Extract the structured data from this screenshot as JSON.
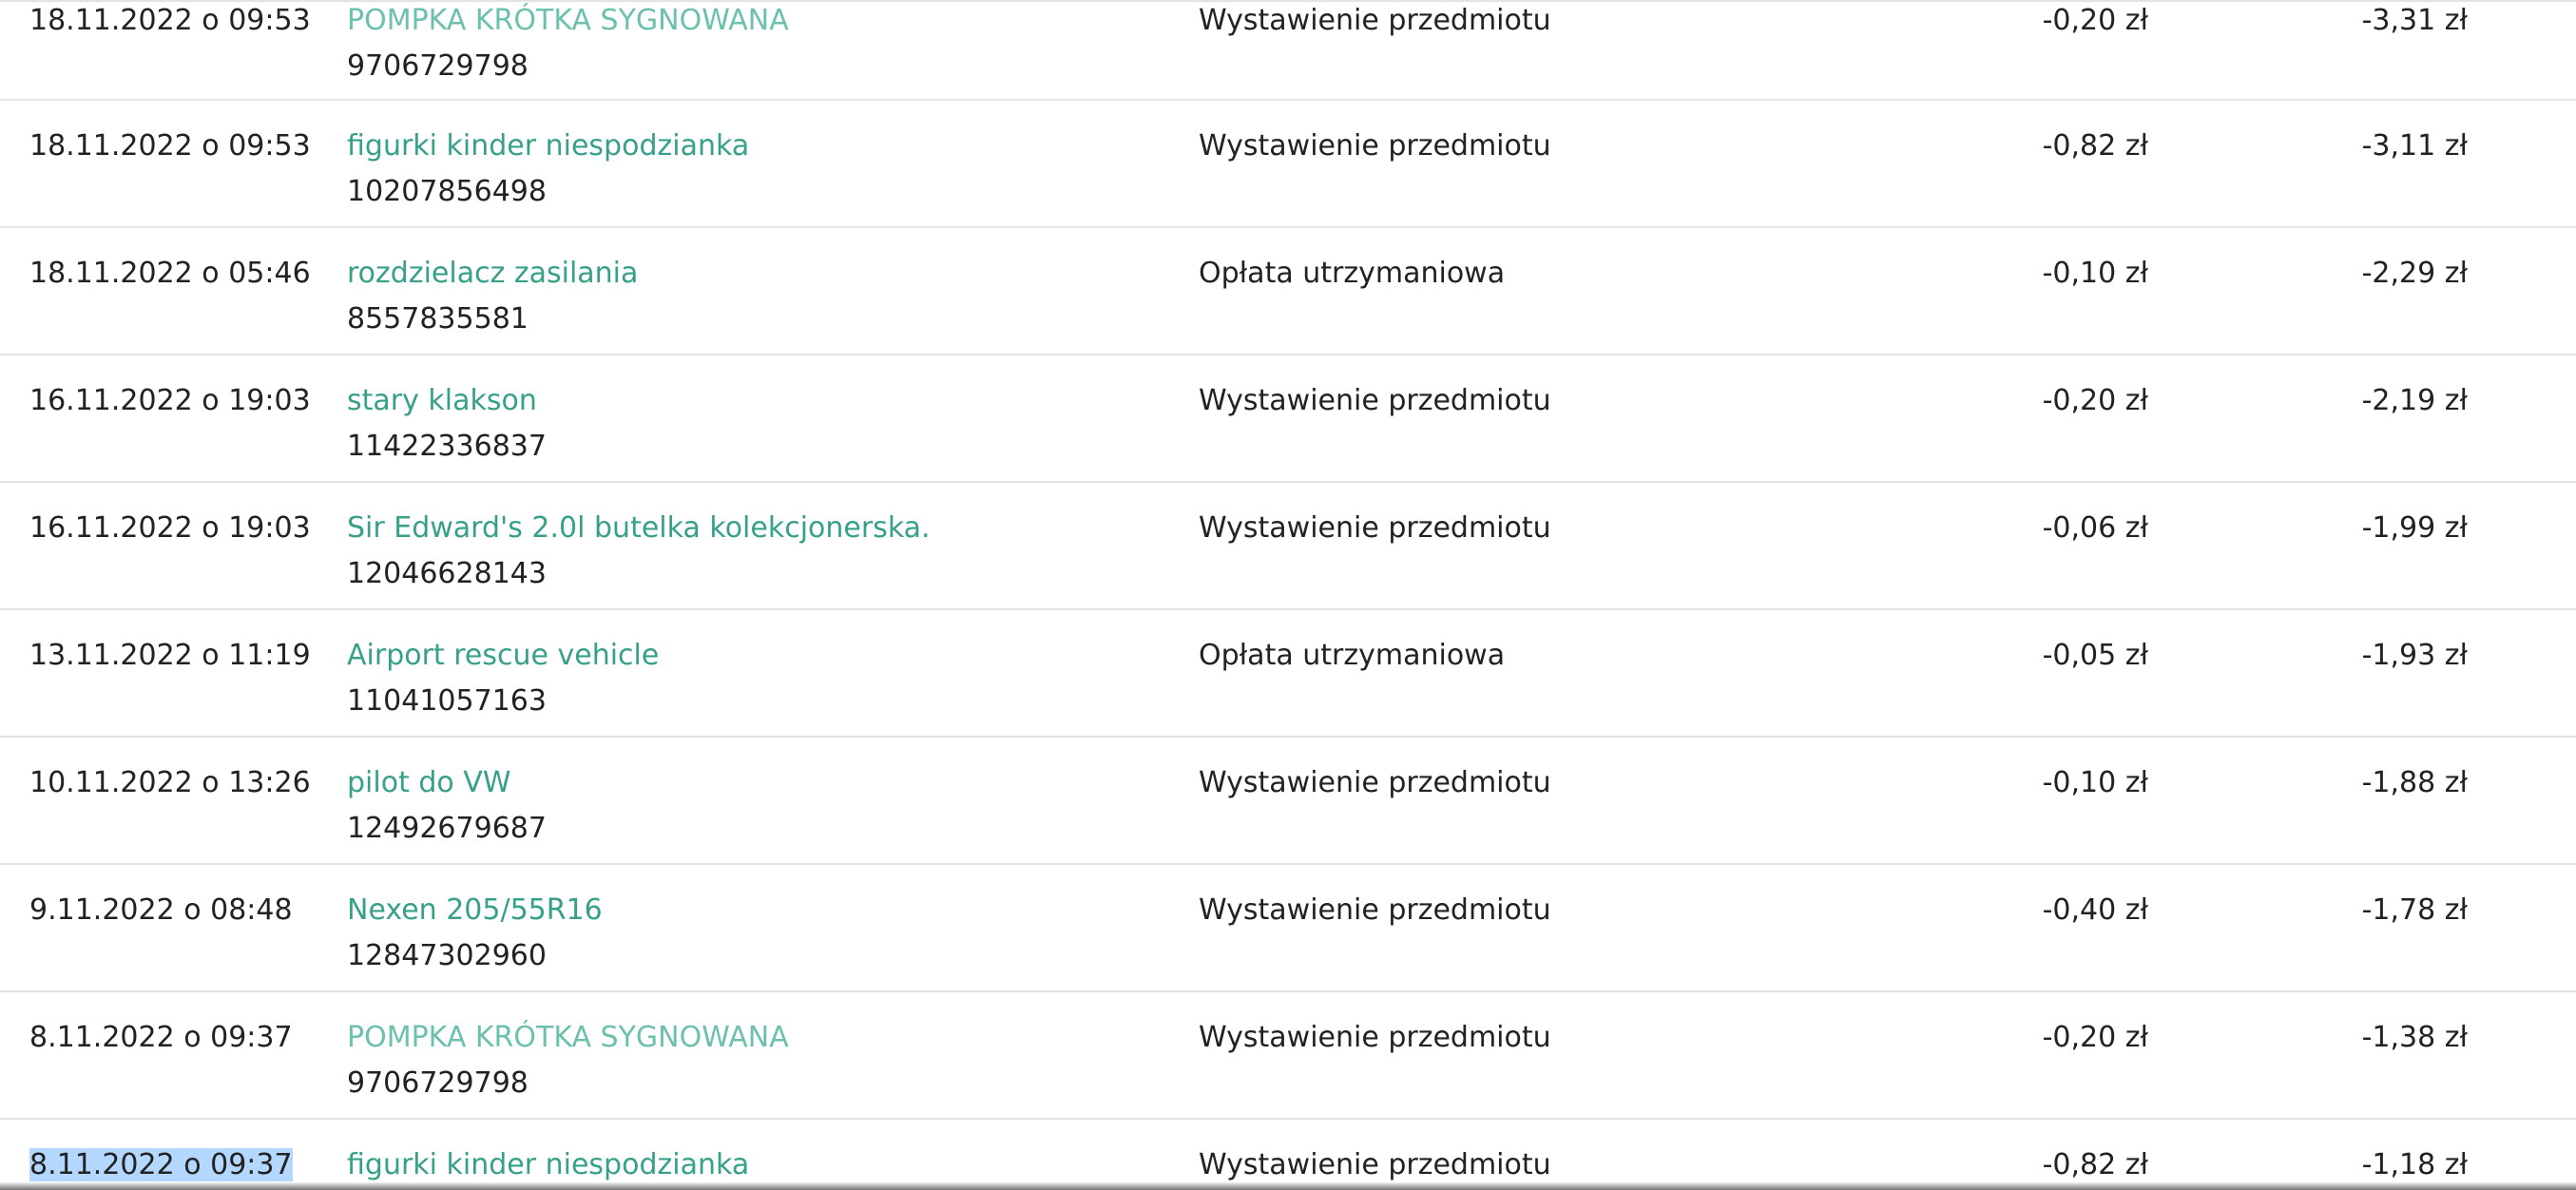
{
  "rows": [
    {
      "date": "18.11.2022 o 09:53",
      "title": "POMPKA KRÓTKA SYGNOWANA",
      "offer_id": "9706729798",
      "type": "Wystawienie przedmiotu",
      "amount": "-0,20 zł",
      "balance": "-3,31 zł"
    },
    {
      "date": "18.11.2022 o 09:53",
      "title": "figurki kinder niespodzianka",
      "offer_id": "10207856498",
      "type": "Wystawienie przedmiotu",
      "amount": "-0,82 zł",
      "balance": "-3,11 zł"
    },
    {
      "date": "18.11.2022 o 05:46",
      "title": "rozdzielacz zasilania",
      "offer_id": "8557835581",
      "type": "Opłata utrzymaniowa",
      "amount": "-0,10 zł",
      "balance": "-2,29 zł"
    },
    {
      "date": "16.11.2022 o 19:03",
      "title": "stary klakson",
      "offer_id": "11422336837",
      "type": "Wystawienie przedmiotu",
      "amount": "-0,20 zł",
      "balance": "-2,19 zł"
    },
    {
      "date": "16.11.2022 o 19:03",
      "title": "Sir Edward's 2.0l butelka kolekcjonerska.",
      "offer_id": "12046628143",
      "type": "Wystawienie przedmiotu",
      "amount": "-0,06 zł",
      "balance": "-1,99 zł"
    },
    {
      "date": "13.11.2022 o 11:19",
      "title": "Airport rescue vehicle",
      "offer_id": "11041057163",
      "type": "Opłata utrzymaniowa",
      "amount": "-0,05 zł",
      "balance": "-1,93 zł"
    },
    {
      "date": "10.11.2022 o 13:26",
      "title": "pilot do VW",
      "offer_id": "12492679687",
      "type": "Wystawienie przedmiotu",
      "amount": "-0,10 zł",
      "balance": "-1,88 zł"
    },
    {
      "date": "9.11.2022 o 08:48",
      "title": "Nexen 205/55R16",
      "offer_id": "12847302960",
      "type": "Wystawienie przedmiotu",
      "amount": "-0,40 zł",
      "balance": "-1,78 zł"
    },
    {
      "date": "8.11.2022 o 09:37",
      "title": "POMPKA KRÓTKA SYGNOWANA",
      "offer_id": "9706729798",
      "type": "Wystawienie przedmiotu",
      "amount": "-0,20 zł",
      "balance": "-1,38 zł"
    },
    {
      "date": "8.11.2022 o 09:37",
      "title": "figurki kinder niespodzianka",
      "offer_id": "",
      "type": "Wystawienie przedmiotu",
      "amount": "-0,82 zł",
      "balance": "-1,18 zł"
    }
  ],
  "colors": {
    "link": "#36a188",
    "link_faded": "#6cc1ac",
    "text": "#222222",
    "divider": "#e3e3e3",
    "selection": "#b3d7fe"
  }
}
